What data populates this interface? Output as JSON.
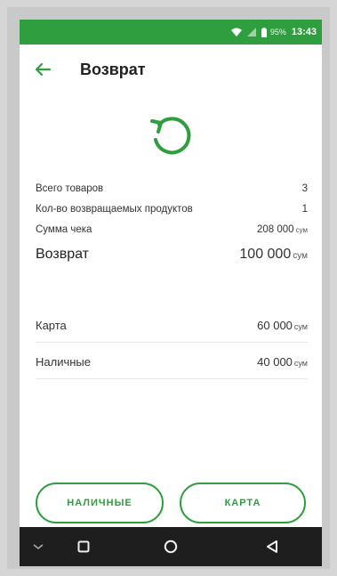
{
  "status_bar": {
    "battery": "95%",
    "time": "13:43"
  },
  "header": {
    "title": "Возврат"
  },
  "summary": {
    "total_items_label": "Всего товаров",
    "total_items_value": "3",
    "return_count_label": "Кол-во возвращаемых продуктов",
    "return_count_value": "1",
    "receipt_sum_label": "Сумма чека",
    "receipt_sum_value": "208 000",
    "receipt_sum_unit": "сум",
    "refund_label": "Возврат",
    "refund_value": "100 000",
    "refund_unit": "сум"
  },
  "payments": {
    "card_label": "Карта",
    "card_value": "60 000",
    "card_unit": "сум",
    "cash_label": "Наличные",
    "cash_value": "40 000",
    "cash_unit": "сум"
  },
  "actions": {
    "cash_button": "НАЛИЧНЫЕ",
    "card_button": "КАРТА"
  },
  "colors": {
    "accent": "#2f9e3f",
    "nav_bar": "#1e1e1e"
  },
  "icons": [
    "wifi-icon",
    "signal-icon",
    "battery-icon",
    "back-arrow-icon",
    "refund-icon",
    "nav-back-icon",
    "nav-home-icon",
    "nav-recents-icon",
    "nav-collapse-icon"
  ]
}
